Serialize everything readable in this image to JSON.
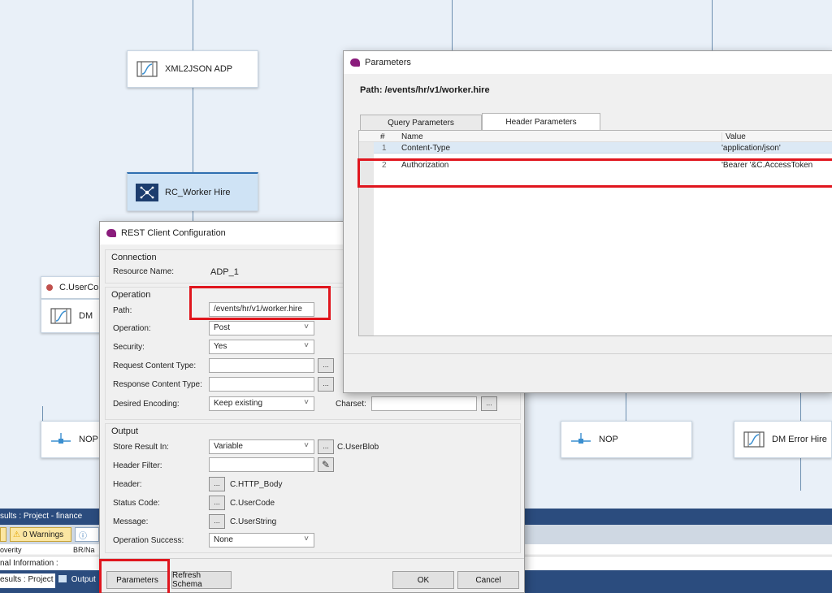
{
  "canvas": {
    "nodes": {
      "xml2json": "XML2JSON ADP",
      "rc_worker": "RC_Worker Hire",
      "user_co": "C.UserCo",
      "dm_left": "DM",
      "nop_left": "NOP",
      "nop_mid": "NOP",
      "dm_error": "DM Error Hire"
    }
  },
  "results_panel": {
    "title": "sults : Project - finance",
    "warnings": "0 Warnings",
    "col_partial": "BR/Na",
    "row_partial": "overity",
    "info_label": "nal Information :",
    "tab_results": "esults : Project",
    "tab_output": "Output"
  },
  "rest_dialog": {
    "title": "REST Client Configuration",
    "connection_header": "Connection",
    "resource_label": "Resource Name:",
    "resource_value": "ADP_1",
    "operation_header": "Operation",
    "path_label": "Path:",
    "path_value": "/events/hr/v1/worker.hire",
    "operation_label": "Operation:",
    "operation_value": "Post",
    "security_label": "Security:",
    "security_value": "Yes",
    "req_ct_label": "Request Content Type:",
    "req_ct_value": "",
    "resp_ct_label": "Response Content Type:",
    "resp_ct_value": "",
    "encoding_label": "Desired Encoding:",
    "encoding_value": "Keep existing",
    "charset_label": "Charset:",
    "charset_value": "",
    "output_header": "Output",
    "store_label": "Store Result In:",
    "store_value": "Variable",
    "store_var": "C.UserBlob",
    "hfilter_label": "Header Filter:",
    "hfilter_value": "",
    "header_label": "Header:",
    "header_var": "C.HTTP_Body",
    "status_label": "Status Code:",
    "status_var": "C.UserCode",
    "message_label": "Message:",
    "message_var": "C.UserString",
    "success_label": "Operation Success:",
    "success_value": "None",
    "btn_parameters": "Parameters",
    "btn_refresh": "Refresh Schema",
    "btn_ok": "OK",
    "btn_cancel": "Cancel",
    "ellipsis": "..."
  },
  "params_dialog": {
    "title": "Parameters",
    "path": "Path: /events/hr/v1/worker.hire",
    "tabs": [
      "Query Parameters",
      "Header Parameters"
    ],
    "columns": {
      "num": "#",
      "name": "Name",
      "value": "Value"
    },
    "rows": [
      {
        "num": "1",
        "name": "Content-Type",
        "value": "'application/json'"
      },
      {
        "num": "2",
        "name": "Authorization",
        "value": "'Bearer '&C.AccessToken"
      }
    ]
  },
  "colors": {
    "highlight": "#e0161e",
    "brand": "#8a1c7c",
    "canvas_bg": "#e9f0f8"
  }
}
